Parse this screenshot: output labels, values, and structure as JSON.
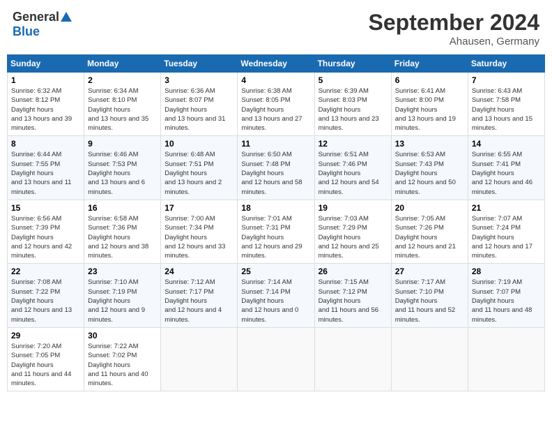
{
  "header": {
    "logo_general": "General",
    "logo_blue": "Blue",
    "title": "September 2024",
    "subtitle": "Ahausen, Germany"
  },
  "days_of_week": [
    "Sunday",
    "Monday",
    "Tuesday",
    "Wednesday",
    "Thursday",
    "Friday",
    "Saturday"
  ],
  "weeks": [
    [
      {
        "day": "1",
        "sunrise": "6:32 AM",
        "sunset": "8:12 PM",
        "daylight": "13 hours and 39 minutes."
      },
      {
        "day": "2",
        "sunrise": "6:34 AM",
        "sunset": "8:10 PM",
        "daylight": "13 hours and 35 minutes."
      },
      {
        "day": "3",
        "sunrise": "6:36 AM",
        "sunset": "8:07 PM",
        "daylight": "13 hours and 31 minutes."
      },
      {
        "day": "4",
        "sunrise": "6:38 AM",
        "sunset": "8:05 PM",
        "daylight": "13 hours and 27 minutes."
      },
      {
        "day": "5",
        "sunrise": "6:39 AM",
        "sunset": "8:03 PM",
        "daylight": "13 hours and 23 minutes."
      },
      {
        "day": "6",
        "sunrise": "6:41 AM",
        "sunset": "8:00 PM",
        "daylight": "13 hours and 19 minutes."
      },
      {
        "day": "7",
        "sunrise": "6:43 AM",
        "sunset": "7:58 PM",
        "daylight": "13 hours and 15 minutes."
      }
    ],
    [
      {
        "day": "8",
        "sunrise": "6:44 AM",
        "sunset": "7:55 PM",
        "daylight": "13 hours and 11 minutes."
      },
      {
        "day": "9",
        "sunrise": "6:46 AM",
        "sunset": "7:53 PM",
        "daylight": "13 hours and 6 minutes."
      },
      {
        "day": "10",
        "sunrise": "6:48 AM",
        "sunset": "7:51 PM",
        "daylight": "13 hours and 2 minutes."
      },
      {
        "day": "11",
        "sunrise": "6:50 AM",
        "sunset": "7:48 PM",
        "daylight": "12 hours and 58 minutes."
      },
      {
        "day": "12",
        "sunrise": "6:51 AM",
        "sunset": "7:46 PM",
        "daylight": "12 hours and 54 minutes."
      },
      {
        "day": "13",
        "sunrise": "6:53 AM",
        "sunset": "7:43 PM",
        "daylight": "12 hours and 50 minutes."
      },
      {
        "day": "14",
        "sunrise": "6:55 AM",
        "sunset": "7:41 PM",
        "daylight": "12 hours and 46 minutes."
      }
    ],
    [
      {
        "day": "15",
        "sunrise": "6:56 AM",
        "sunset": "7:39 PM",
        "daylight": "12 hours and 42 minutes."
      },
      {
        "day": "16",
        "sunrise": "6:58 AM",
        "sunset": "7:36 PM",
        "daylight": "12 hours and 38 minutes."
      },
      {
        "day": "17",
        "sunrise": "7:00 AM",
        "sunset": "7:34 PM",
        "daylight": "12 hours and 33 minutes."
      },
      {
        "day": "18",
        "sunrise": "7:01 AM",
        "sunset": "7:31 PM",
        "daylight": "12 hours and 29 minutes."
      },
      {
        "day": "19",
        "sunrise": "7:03 AM",
        "sunset": "7:29 PM",
        "daylight": "12 hours and 25 minutes."
      },
      {
        "day": "20",
        "sunrise": "7:05 AM",
        "sunset": "7:26 PM",
        "daylight": "12 hours and 21 minutes."
      },
      {
        "day": "21",
        "sunrise": "7:07 AM",
        "sunset": "7:24 PM",
        "daylight": "12 hours and 17 minutes."
      }
    ],
    [
      {
        "day": "22",
        "sunrise": "7:08 AM",
        "sunset": "7:22 PM",
        "daylight": "12 hours and 13 minutes."
      },
      {
        "day": "23",
        "sunrise": "7:10 AM",
        "sunset": "7:19 PM",
        "daylight": "12 hours and 9 minutes."
      },
      {
        "day": "24",
        "sunrise": "7:12 AM",
        "sunset": "7:17 PM",
        "daylight": "12 hours and 4 minutes."
      },
      {
        "day": "25",
        "sunrise": "7:14 AM",
        "sunset": "7:14 PM",
        "daylight": "12 hours and 0 minutes."
      },
      {
        "day": "26",
        "sunrise": "7:15 AM",
        "sunset": "7:12 PM",
        "daylight": "11 hours and 56 minutes."
      },
      {
        "day": "27",
        "sunrise": "7:17 AM",
        "sunset": "7:10 PM",
        "daylight": "11 hours and 52 minutes."
      },
      {
        "day": "28",
        "sunrise": "7:19 AM",
        "sunset": "7:07 PM",
        "daylight": "11 hours and 48 minutes."
      }
    ],
    [
      {
        "day": "29",
        "sunrise": "7:20 AM",
        "sunset": "7:05 PM",
        "daylight": "11 hours and 44 minutes."
      },
      {
        "day": "30",
        "sunrise": "7:22 AM",
        "sunset": "7:02 PM",
        "daylight": "11 hours and 40 minutes."
      },
      null,
      null,
      null,
      null,
      null
    ]
  ]
}
